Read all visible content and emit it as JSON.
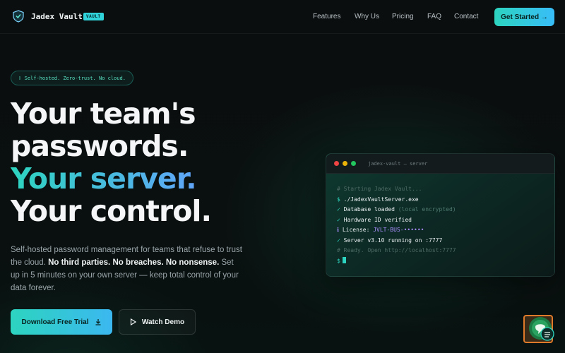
{
  "nav": {
    "brand": "Jadex Vault",
    "badge": "VAULT",
    "links": [
      "Features",
      "Why Us",
      "Pricing",
      "FAQ",
      "Contact"
    ],
    "cta": "Get Started →"
  },
  "hero": {
    "pill": "Self-hosted. Zero-trust. No cloud.",
    "headline": {
      "line1": "Your team's",
      "line2": "passwords.",
      "line3": "Your server.",
      "line4": "Your control."
    },
    "sub": {
      "part1": "Self-hosted password management for teams that refuse to trust the cloud.",
      "bold": "No third parties. No breaches. No nonsense.",
      "part2": "Set up in 5 minutes on your own server — keep total control of your data forever."
    },
    "primary_button": "Download Free Trial",
    "secondary_button": "Watch Demo"
  },
  "terminal": {
    "title": "jadex-vault — server",
    "lines": {
      "l1": "# Starting Jadex Vault...",
      "l2_prefix": "$ ",
      "l2": "./JadexVaultServer.exe",
      "l3_prefix": "✓ ",
      "l3": "Database loaded ",
      "l3_dim": "(local encrypted)",
      "l4_prefix": "✓ ",
      "l4": "Hardware ID verified",
      "l5_prefix": "ℹ ",
      "l5": "License: ",
      "l5_key": "JVLT-BUS-••••••",
      "l6_prefix": "✓ ",
      "l6": "Server v3.10 running on :7777",
      "l7": "# Ready. Open http://localhost:7777",
      "l8_prompt": "$"
    }
  },
  "colors": {
    "accent_teal": "#2dd4bf",
    "accent_blue": "#60a5fa",
    "background": "#0a0d0e"
  },
  "icons": {
    "logo": "shield-icon",
    "download": "download-icon",
    "play": "play-icon",
    "chat": "chat-support-icon"
  }
}
